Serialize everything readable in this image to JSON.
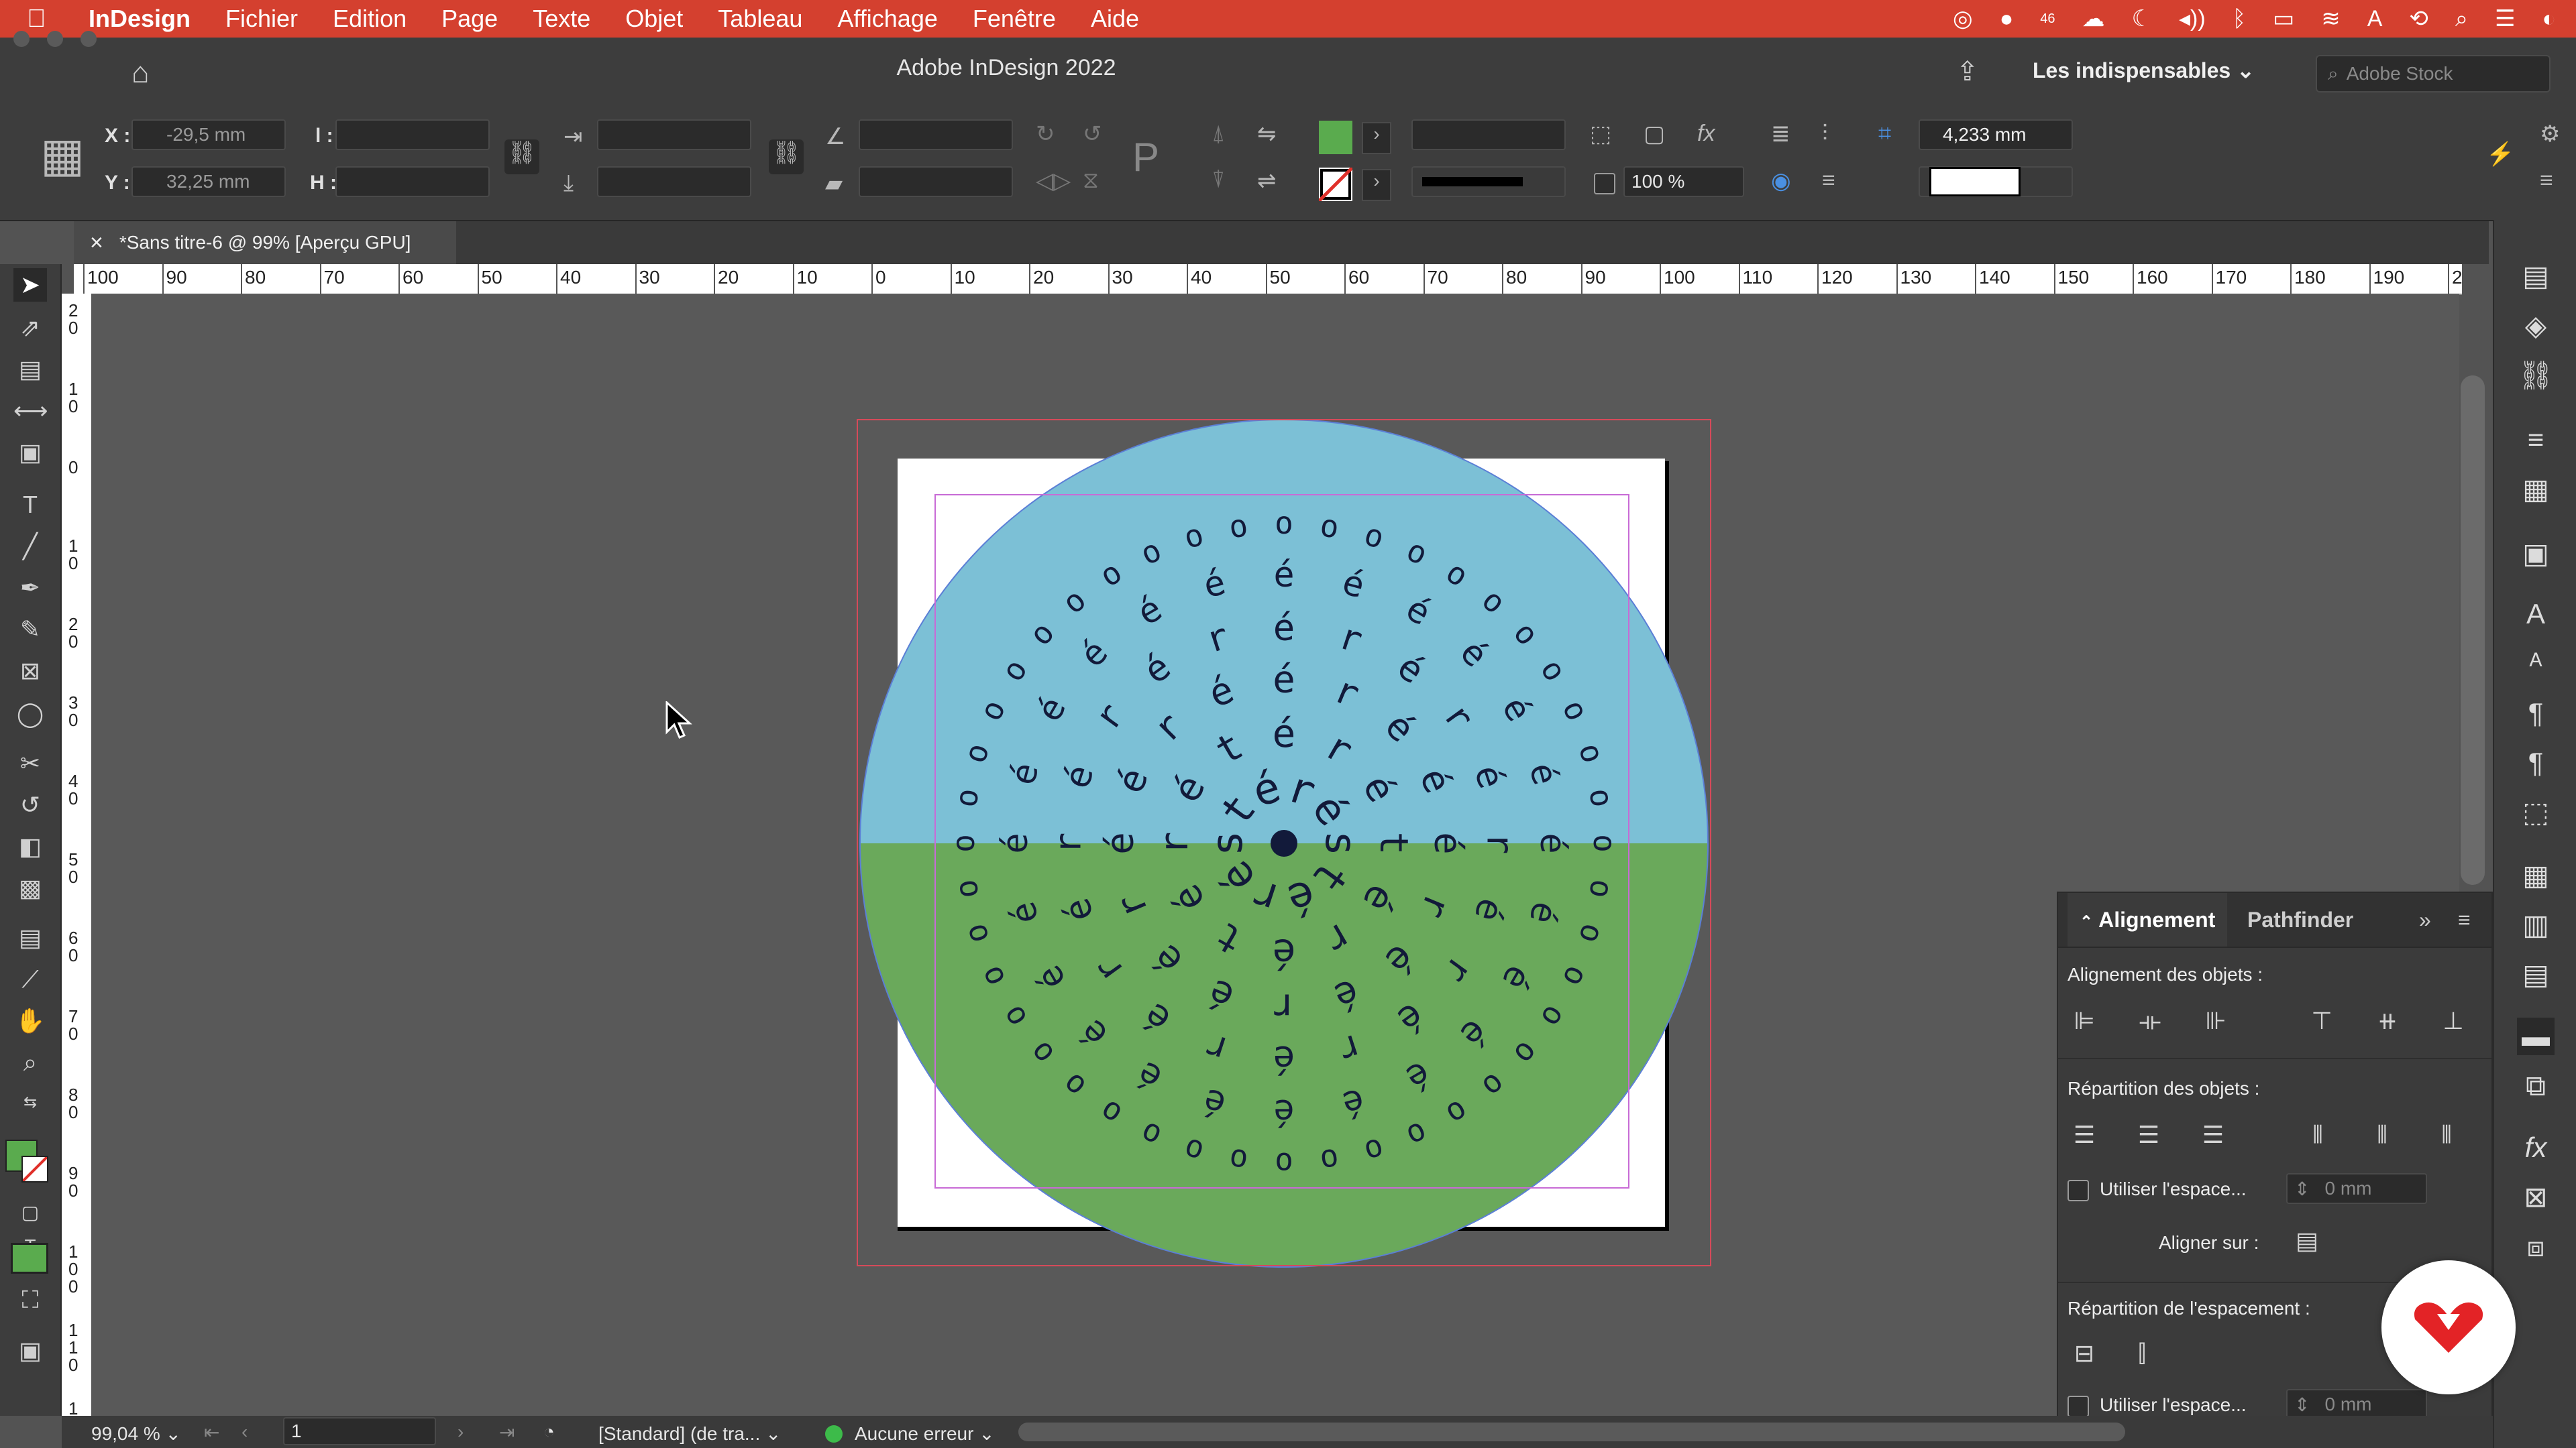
{
  "menubar": {
    "apple": "",
    "app_name": "InDesign",
    "items": [
      "Fichier",
      "Edition",
      "Page",
      "Texte",
      "Objet",
      "Tableau",
      "Affichage",
      "Fenêtre",
      "Aide"
    ],
    "notification_badge": "46"
  },
  "window": {
    "title": "Adobe InDesign 2022",
    "workspace": "Les indispensables",
    "search_placeholder": "Adobe Stock"
  },
  "controlbar": {
    "x_label": "X :",
    "x_value": "-29,5 mm",
    "y_label": "Y :",
    "y_value": "32,25 mm",
    "w_label": "l :",
    "h_label": "H :",
    "scale_value": "100 %",
    "stroke_weight": "4,233 mm",
    "fill_color": "#5aab4e"
  },
  "document": {
    "tab_title": "*Sans titre-6 @ 99% [Aperçu GPU]",
    "close_glyph": "×"
  },
  "ruler": {
    "top_ticks": [
      "100",
      "90",
      "80",
      "70",
      "60",
      "50",
      "40",
      "30",
      "20",
      "10",
      "0",
      "10",
      "20",
      "30",
      "40",
      "50",
      "60",
      "70",
      "80",
      "90",
      "100",
      "110",
      "120",
      "130",
      "140",
      "150",
      "160",
      "170",
      "180",
      "190",
      "2"
    ],
    "left_ticks": [
      "2\n0",
      "1\n0",
      "0",
      "1\n0",
      "2\n0",
      "3\n0",
      "4\n0",
      "5\n0",
      "6\n0",
      "7\n0",
      "8\n0",
      "9\n0",
      "1\n0\n0",
      "1\n1\n0",
      "1\n2"
    ]
  },
  "artwork": {
    "top_color": "#7cc0d6",
    "bottom_color": "#6aa95b",
    "text_color": "#121a3a",
    "rings": [
      {
        "text": "s t é r é",
        "letters": 10
      },
      {
        "text": "t é r é",
        "letters": 12
      },
      {
        "text": "é r é",
        "letters": 16
      },
      {
        "text": "r é",
        "letters": 20
      },
      {
        "text": "é",
        "letters": 24
      },
      {
        "text": "o",
        "letters": 44
      }
    ]
  },
  "statusbar": {
    "zoom": "99,04 %",
    "page": "1",
    "preflight_profile": "[Standard] (de tra...",
    "preflight_status": "Aucune erreur"
  },
  "align_panel": {
    "tab_active": "Alignement",
    "tab_other": "Pathfinder",
    "section_align": "Alignement des objets :",
    "section_distribute": "Répartition des objets :",
    "use_spacing_label": "Utiliser l'espace...",
    "spacing_value": "0 mm",
    "align_to_label": "Aligner sur :",
    "section_spacing": "Répartition de l'espacement :",
    "use_spacing_label_2": "Utiliser l'espace...",
    "spacing_value_2": "0 mm"
  }
}
